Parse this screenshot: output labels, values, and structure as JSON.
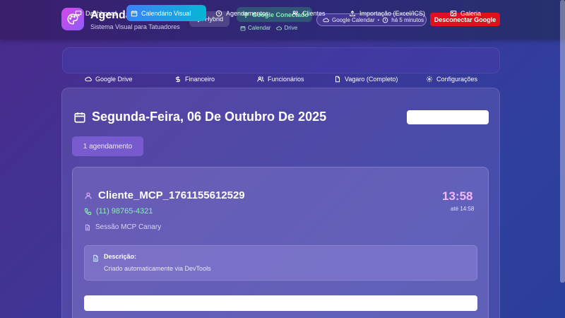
{
  "header": {
    "title": "Agenda Híbrida",
    "subtitle": "Sistema Visual para Tatuadores",
    "mode_chip": "Hybrid",
    "google_status": "Google Conectado",
    "google_services": [
      "Calendar",
      "Drive"
    ],
    "gcal_label": "Google Calendar",
    "gcal_sep": "•",
    "gcal_sync": "há 5 minutos",
    "disconnect_label": "Desconectar Google"
  },
  "nav": {
    "primary": [
      {
        "label": "Dashboard",
        "icon": "monitor-icon",
        "active": false
      },
      {
        "label": "Calendário Visual",
        "icon": "calendar-icon",
        "active": true
      },
      {
        "label": "Agendamentos",
        "icon": "clock-icon",
        "active": false
      },
      {
        "label": "Clientes",
        "icon": "users-icon",
        "active": false
      },
      {
        "label": "Importação (Excel/ICS)",
        "icon": "upload-icon",
        "active": false
      },
      {
        "label": "Galeria",
        "icon": "image-icon",
        "active": false
      }
    ],
    "secondary": [
      {
        "label": "Google Drive",
        "icon": "cloud-icon"
      },
      {
        "label": "Financeiro",
        "icon": "dollar-icon"
      },
      {
        "label": "Funcionários",
        "icon": "users-icon"
      },
      {
        "label": "Vagaro (Completo)",
        "icon": "file-icon"
      },
      {
        "label": "Configurações",
        "icon": "gear-icon"
      }
    ]
  },
  "day": {
    "title": "Segunda-Feira, 06 De Outubro De 2025",
    "count_label": "1 agendamento"
  },
  "appointment": {
    "client": "Cliente_MCP_1761155612529",
    "phone": "(11) 98765-4321",
    "session": "Sessão MCP Canary",
    "start": "13:58",
    "end_label": "até 14:58",
    "desc_label": "Descrição:",
    "desc_text": "Criado automaticamente via DevTools"
  },
  "colors": {
    "accent": "#3b82f6",
    "danger": "#e0101e",
    "success": "#86efac",
    "time": "#f0b8ff"
  }
}
